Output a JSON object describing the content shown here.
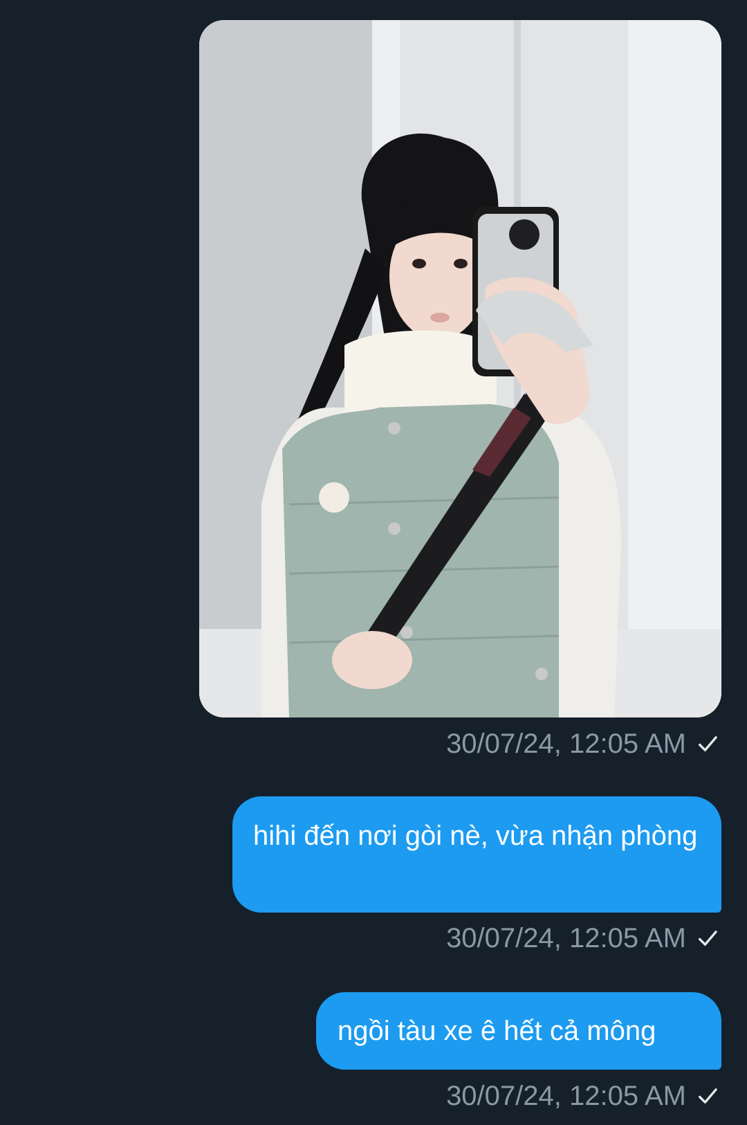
{
  "theme": {
    "background": "#15202b",
    "bubble_color": "#1d9bf0",
    "meta_color": "#8b98a5",
    "text_color": "#ffffff"
  },
  "messages": [
    {
      "type": "image",
      "image_alt": "mirror selfie photo",
      "timestamp": "30/07/24, 12:05 AM",
      "status_icon": "checkmark-icon"
    },
    {
      "type": "text",
      "text": "hihi đến nơi gòi nè, vừa nhận phòng",
      "timestamp": "30/07/24, 12:05 AM",
      "status_icon": "checkmark-icon"
    },
    {
      "type": "text",
      "text": "ngồi tàu xe ê hết cả mông",
      "timestamp": "30/07/24, 12:05 AM",
      "status_icon": "checkmark-icon"
    }
  ]
}
